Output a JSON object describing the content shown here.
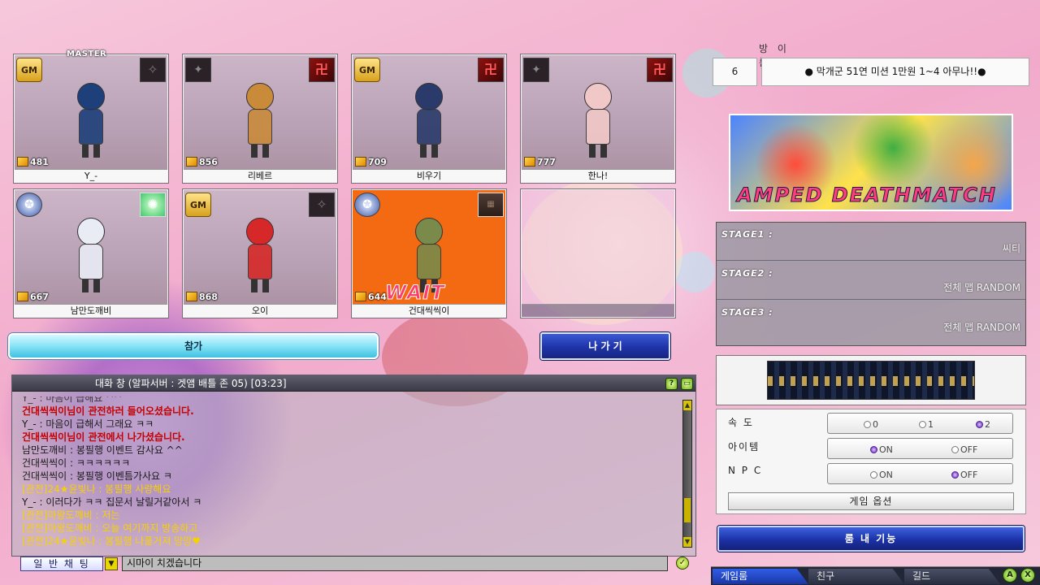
{
  "players": [
    {
      "name": "Y_-",
      "level": "481",
      "master": true,
      "gm": true,
      "team_icon": "blade-emblem",
      "state": "ready"
    },
    {
      "name": "리베르",
      "level": "856",
      "master": false,
      "gm": false,
      "team_icon": "red-emblem",
      "state": "ready"
    },
    {
      "name": "비우기",
      "level": "709",
      "master": false,
      "gm": true,
      "team_icon": "red-emblem",
      "state": "ready"
    },
    {
      "name": "한나!",
      "level": "777",
      "master": false,
      "gm": false,
      "team_icon": "red-emblem",
      "state": "ready"
    },
    {
      "name": "남만도깨비",
      "level": "667",
      "master": false,
      "gm": false,
      "team_icon": "green-orb-emblem",
      "state": "ready"
    },
    {
      "name": "오이",
      "level": "868",
      "master": false,
      "gm": true,
      "team_icon": "blade-emblem",
      "state": "ready"
    },
    {
      "name": "건대씩씩이",
      "level": "644",
      "master": false,
      "gm": false,
      "team_icon": "photo-emblem",
      "state": "wait"
    },
    {
      "name": "",
      "level": "",
      "master": false,
      "gm": false,
      "team_icon": "",
      "state": "empty"
    }
  ],
  "labels": {
    "master": "MASTER",
    "gm": "GM",
    "wait": "WAIT",
    "join_button": "참가",
    "exit_button": "나 가 기"
  },
  "chat": {
    "title": "대화 창 (알파서버 : 겟앰 배틀 존 05) [03:23]",
    "messages": [
      {
        "text": "Y_- : 마음이 급해요 ^^",
        "style": "cut"
      },
      {
        "text": "건대씩씩이님이 관전하러 들어오셨습니다.",
        "style": "red"
      },
      {
        "text": "Y_- : 마음이 급해서 그래요 ㅋㅋ",
        "style": "normal"
      },
      {
        "text": "건대씩씩이님이 관전에서 나가셨습니다.",
        "style": "red"
      },
      {
        "text": "남만도깨비 : 봉필행 이벤트 감사요 ^^",
        "style": "normal"
      },
      {
        "text": "건대씩씩이 : ㅋㅋㅋㅋㅋㅋ",
        "style": "normal"
      },
      {
        "text": "건대씩씩이 : 봉필행 이벤틈가사요 ㅋ",
        "style": "normal"
      },
      {
        "text": "[관전]24★윤빛나 : 봉필행 사랑해요",
        "style": "yellow"
      },
      {
        "text": "Y_- : 이러다가 ㅋㅋ 집문서 날릴거같아서 ㅋ",
        "style": "normal"
      },
      {
        "text": "[관전]마왕도깨비 : 저는",
        "style": "yellow"
      },
      {
        "text": "[관전]마왕도깨비 : 오늘 여기까지 방송하고",
        "style": "yellow"
      },
      {
        "text": "[관전]24★윤빛나 : 봉필행 나풀거져 망망♥",
        "style": "yellow"
      }
    ],
    "mode": "일 반 채 팅",
    "input_value": "시마이 치겠습니다"
  },
  "room": {
    "label": "방 이 름",
    "number": "6",
    "title": "● 막개군 51연 미션 1만원 1~4 아무나!!●",
    "map_name": "AMPED DEATHMATCH"
  },
  "stages": [
    {
      "label": "STAGE1 :",
      "value": "씨티"
    },
    {
      "label": "STAGE2 :",
      "value": "전체 맵 RANDOM"
    },
    {
      "label": "STAGE3 :",
      "value": "전체 맵 RANDOM"
    }
  ],
  "options": {
    "speed": {
      "label": "속 도",
      "choices": [
        "0",
        "1",
        "2"
      ],
      "selected": "2"
    },
    "item": {
      "label": "아이템",
      "choices": [
        "ON",
        "OFF"
      ],
      "selected": "ON"
    },
    "npc": {
      "label": "N P C",
      "choices": [
        "ON",
        "OFF"
      ],
      "selected": "OFF"
    },
    "game_options_button": "게임 옵션"
  },
  "room_function_button": "룸 내 기능",
  "bottom_tabs": [
    "게임룸",
    "친구",
    "길드"
  ],
  "corner_buttons": [
    "A",
    "X"
  ]
}
